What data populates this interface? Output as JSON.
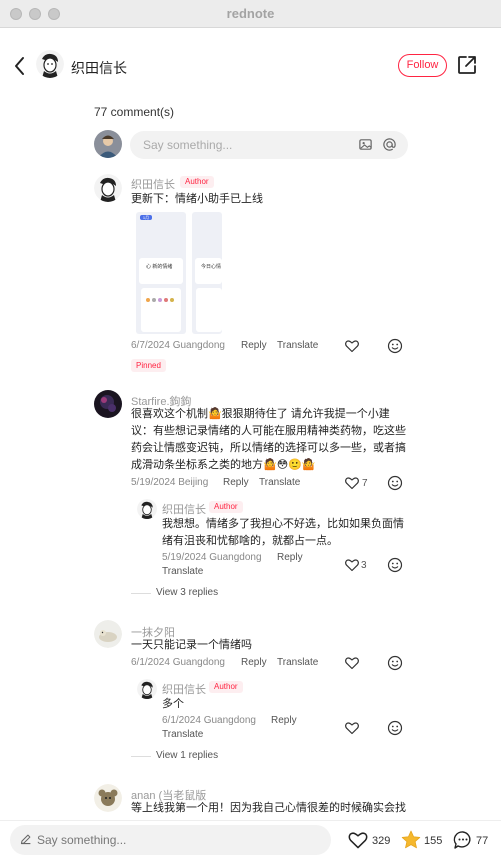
{
  "window": {
    "title": "rednote"
  },
  "header": {
    "author_name": "织田信长",
    "follow_label": "Follow"
  },
  "comments_section": {
    "count_label": "77 comment(s)",
    "input_placeholder": "Say something..."
  },
  "comments": [
    {
      "nickname": "织田信长",
      "badge": "Author",
      "text": "更新下：情绪小助手已上线",
      "meta": "6/7/2024 Guangdong",
      "reply_label": "Reply",
      "translate_label": "Translate",
      "pinned_label": "Pinned",
      "image_snippets": [
        "1月",
        "心 新的情绪",
        "今日心情"
      ]
    },
    {
      "nickname": "Starfire.鉤鉤",
      "text_lines": [
        "很喜欢这个机制🤷狠狠期待住了 请允许我提一个小建",
        "议：有些想记录情绪的人可能在服用精神类药物，吃这些",
        "药会让情感变迟钝，所以情绪的选择可以多一些，或者搞",
        "成滑动条坐标系之类的地方🤷😳🙂🤷"
      ],
      "meta": "5/19/2024 Beijing",
      "reply_label": "Reply",
      "translate_label": "Translate",
      "likes": "7",
      "reply": {
        "nickname": "织田信长",
        "badge": "Author",
        "text_lines": [
          "我想想。情绪多了我担心不好选，比如如果负面情",
          "绪有沮丧和忧郁啥的，就都占一点。"
        ],
        "meta": "5/19/2024 Guangdong",
        "reply_label": "Reply",
        "translate_label": "Translate",
        "likes": "3"
      },
      "view_replies": "View 3 replies"
    },
    {
      "nickname": "一抹夕阳",
      "text": "一天只能记录一个情绪吗",
      "meta": "6/1/2024 Guangdong",
      "reply_label": "Reply",
      "translate_label": "Translate",
      "reply": {
        "nickname": "织田信长",
        "badge": "Author",
        "text": "多个",
        "meta": "6/1/2024 Guangdong",
        "reply_label": "Reply",
        "translate_label": "Translate"
      },
      "view_replies": "View 1 replies"
    },
    {
      "nickname": "anan (当老鼠版",
      "text": "等上线我第一个用！因为我自己心情很差的时候确实会找"
    }
  ],
  "bottom_bar": {
    "placeholder": "Say something...",
    "likes": "329",
    "collects": "155",
    "comments": "77"
  },
  "colors": {
    "accent": "#ff2442",
    "star": "#f5b82e"
  }
}
